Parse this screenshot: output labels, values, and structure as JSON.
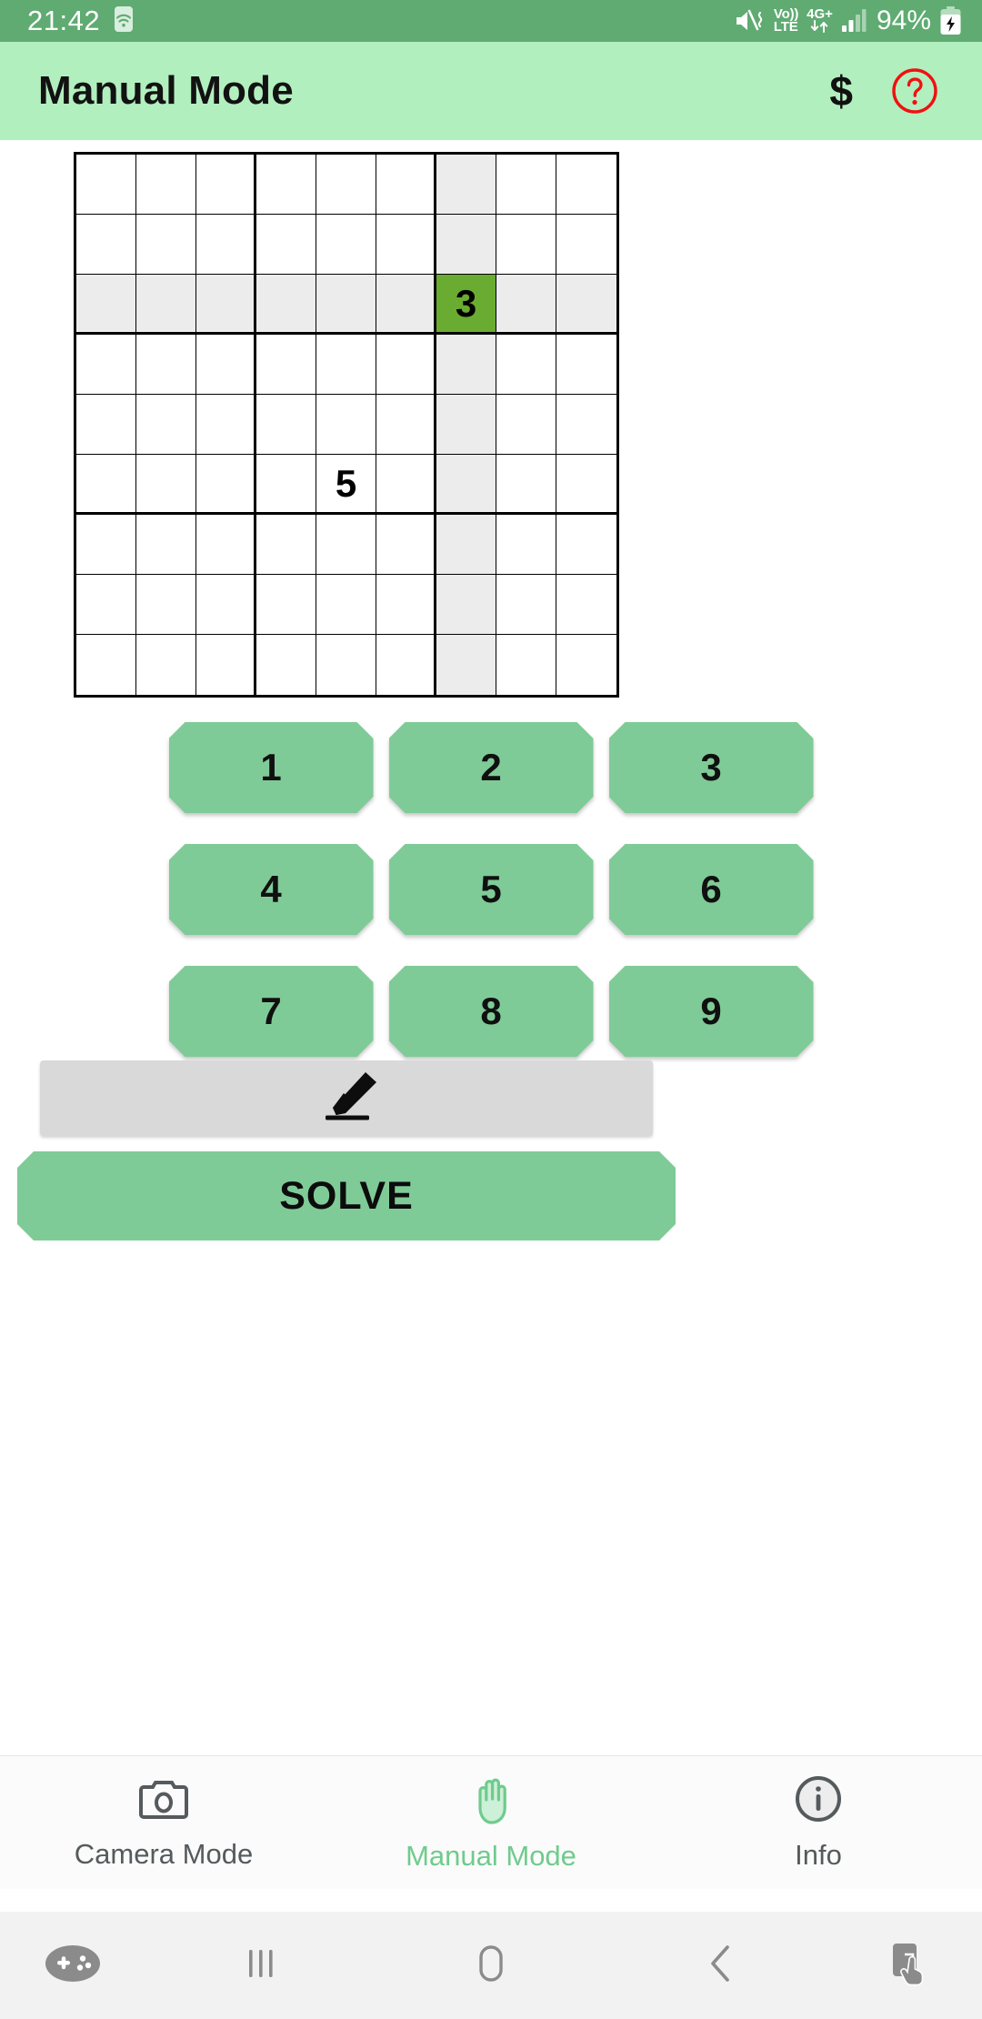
{
  "status_bar": {
    "time": "21:42",
    "wifi_icon": "wifi-icon",
    "mute_icon": "mute-icon",
    "volte_top": "Vo))",
    "volte_bottom": "LTE",
    "network_type": "4G+",
    "data_arrows_icon": "data-transfer-icon",
    "signal_icon": "signal-bars-icon",
    "battery_percent": "94%",
    "battery_icon": "battery-charging-icon",
    "background_color": "#5fab72"
  },
  "app_bar": {
    "title": "Manual Mode",
    "dollar_label": "$",
    "dollar_icon": "dollar-icon",
    "help_icon": "help-circle-icon",
    "help_color": "#f01111",
    "background_color": "#b2efbf"
  },
  "board": {
    "rows": 9,
    "columns": 9,
    "selected_cell": {
      "row": 3,
      "col": 7,
      "value": "3"
    },
    "highlight_row": 3,
    "highlight_col": 7,
    "highlight_color": "#ececec",
    "selected_color": "#6aab31",
    "values": [
      [
        "",
        "",
        "",
        "",
        "",
        "",
        "",
        "",
        ""
      ],
      [
        "",
        "",
        "",
        "",
        "",
        "",
        "",
        "",
        ""
      ],
      [
        "",
        "",
        "",
        "",
        "",
        "",
        "3",
        "",
        ""
      ],
      [
        "",
        "",
        "",
        "",
        "",
        "",
        "",
        "",
        ""
      ],
      [
        "",
        "",
        "",
        "",
        "",
        "",
        "",
        "",
        ""
      ],
      [
        "",
        "",
        "",
        "",
        "5",
        "",
        "",
        "",
        ""
      ],
      [
        "",
        "",
        "",
        "",
        "",
        "",
        "",
        "",
        ""
      ],
      [
        "",
        "",
        "",
        "",
        "",
        "",
        "",
        "",
        ""
      ],
      [
        "",
        "",
        "",
        "",
        "",
        "",
        "",
        "",
        ""
      ]
    ]
  },
  "numpad": {
    "button_color": "#7fcb97",
    "rows": [
      [
        "1",
        "2",
        "3"
      ],
      [
        "4",
        "5",
        "6"
      ],
      [
        "7",
        "8",
        "9"
      ]
    ]
  },
  "eraser": {
    "icon": "eraser-icon",
    "background_color": "#d9d9d9"
  },
  "solve": {
    "label": "SOLVE",
    "background_color": "#7fcb97"
  },
  "tab_bar": {
    "active_color": "#6fcb8d",
    "inactive_color": "#555a5c",
    "items": [
      {
        "label": "Camera Mode",
        "icon": "camera-icon",
        "active": false
      },
      {
        "label": "Manual Mode",
        "icon": "hand-icon",
        "active": true
      },
      {
        "label": "Info",
        "icon": "info-circle-icon",
        "active": false
      }
    ]
  },
  "nav_bar": {
    "background_color": "#f2f2f2",
    "items": [
      {
        "icon": "game-controller-icon"
      },
      {
        "icon": "recents-icon"
      },
      {
        "icon": "home-icon"
      },
      {
        "icon": "back-icon"
      },
      {
        "icon": "screenshot-touch-icon"
      }
    ]
  }
}
